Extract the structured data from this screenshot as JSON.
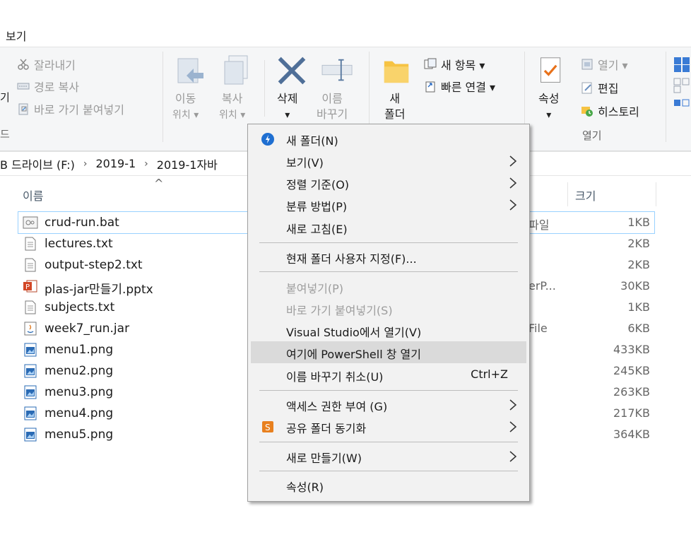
{
  "ribbon": {
    "view_tab": "보기",
    "clipboard": {
      "cut": "잘라내기",
      "copy_path": "경로 복사",
      "paste_shortcut": "바로 가기 붙여넣기",
      "group_label": "드",
      "left_fragment": "기"
    },
    "organize": {
      "move_to": [
        "이동",
        "위치 ▾"
      ],
      "copy_to": [
        "복사",
        "위치 ▾"
      ],
      "delete": [
        "삭제",
        "▾"
      ],
      "rename": [
        "이름",
        "바꾸기"
      ]
    },
    "new": {
      "new_folder": [
        "새",
        "폴더"
      ],
      "new_item": "새 항목 ▾",
      "easy_access": "빠른 연결 ▾"
    },
    "open": {
      "properties": [
        "속성",
        "▾"
      ],
      "open_btn": "열기 ▾",
      "edit": "편집",
      "history": "히스토리",
      "group_label": "열기"
    }
  },
  "address": {
    "crumbs": [
      "B 드라이브 (F:)",
      "2019-1",
      "2019-1자바"
    ]
  },
  "columns": {
    "name": "이름",
    "size": "크기",
    "sort_glyph": "^"
  },
  "files": [
    {
      "name": "crud-run.bat",
      "type": "파일",
      "size": "1KB",
      "icon": "bat-icon"
    },
    {
      "name": "lectures.txt",
      "type": "",
      "size": "2KB",
      "icon": "txt-icon"
    },
    {
      "name": "output-step2.txt",
      "type": "",
      "size": "2KB",
      "icon": "txt-icon"
    },
    {
      "name": "plas-jar만들기.pptx",
      "type": "erP...",
      "size": "30KB",
      "icon": "pptx-icon"
    },
    {
      "name": "subjects.txt",
      "type": "",
      "size": "1KB",
      "icon": "txt-icon"
    },
    {
      "name": "week7_run.jar",
      "type": "File",
      "size": "6KB",
      "icon": "jar-icon"
    },
    {
      "name": "menu1.png",
      "type": "",
      "size": "433KB",
      "icon": "png-icon"
    },
    {
      "name": "menu2.png",
      "type": "",
      "size": "245KB",
      "icon": "png-icon"
    },
    {
      "name": "menu3.png",
      "type": "",
      "size": "263KB",
      "icon": "png-icon"
    },
    {
      "name": "menu4.png",
      "type": "",
      "size": "217KB",
      "icon": "png-icon"
    },
    {
      "name": "menu5.png",
      "type": "",
      "size": "364KB",
      "icon": "png-icon"
    }
  ],
  "context_menu": {
    "items": [
      {
        "label": "새 폴더(N)",
        "icon": "new-folder-icon"
      },
      {
        "label": "보기(V)",
        "submenu": true
      },
      {
        "label": "정렬 기준(O)",
        "submenu": true
      },
      {
        "label": "분류 방법(P)",
        "submenu": true
      },
      {
        "label": "새로 고침(E)"
      },
      {
        "label": "현재 폴더 사용자 지정(F)..."
      },
      {
        "label": "붙여넣기(P)",
        "disabled": true
      },
      {
        "label": "바로 가기 붙여넣기(S)",
        "disabled": true
      },
      {
        "label": "Visual Studio에서 열기(V)"
      },
      {
        "label": "여기에 PowerShell 창 열기",
        "highlighted": true
      },
      {
        "label": "이름 바꾸기 취소(U)",
        "shortcut": "Ctrl+Z"
      },
      {
        "label": "액세스 권한 부여 (G)",
        "submenu": true
      },
      {
        "label": "공유 폴더 동기화",
        "submenu": true,
        "icon": "sync-share-icon"
      },
      {
        "label": "새로 만들기(W)",
        "submenu": true
      },
      {
        "label": "속성(R)"
      }
    ]
  },
  "colors": {
    "menu_bg": "#f2f2f2",
    "menu_highlight": "#dadada",
    "selection_border": "#99d1ff",
    "ribbon_bg": "#f5f6f7"
  }
}
